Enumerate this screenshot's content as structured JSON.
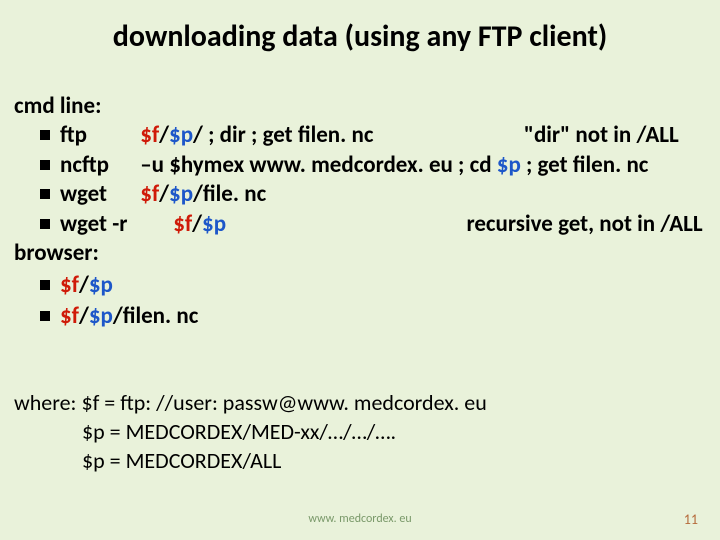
{
  "title": "downloading data (using any FTP client)",
  "labels": {
    "cmd": "cmd line:",
    "browser": "browser:",
    "where": "where:"
  },
  "cmd": {
    "ftp": {
      "name": "ftp",
      "arg_pre": "$f",
      "arg_mid1": "/",
      "arg_p": "$p",
      "arg_mid2": "/  ; dir ; get filen. nc",
      "note": "\"dir\" not in /ALL"
    },
    "ncftp": {
      "name": "ncftp",
      "arg_pre": "–u $hymex   www. medcordex. eu ; cd ",
      "arg_p": "$p",
      "arg_post": "  ; get filen. nc"
    },
    "wget1": {
      "name": "wget",
      "arg_f": "$f",
      "slash1": "/",
      "arg_p": "$p",
      "tail": "/file. nc"
    },
    "wget2": {
      "name": "wget  -r",
      "arg_f": "$f",
      "slash1": "/",
      "arg_p": "$p",
      "note": "recursive get, not in /ALL"
    }
  },
  "browser": {
    "b1": {
      "f": "$f",
      "slash": "/",
      "p": "$p"
    },
    "b2": {
      "f": "$f",
      "slash": "/",
      "p": "$p",
      "tail": "/filen. nc"
    }
  },
  "where": {
    "l1_a": "$f  = ftp: //user: passw@www. medcordex. eu",
    "l2_a": "$p = MEDCORDEX/MED-xx/…/…/….",
    "l3_a": "$p = MEDCORDEX/ALL"
  },
  "footer": {
    "url": "www. medcordex. eu",
    "page": "11"
  }
}
